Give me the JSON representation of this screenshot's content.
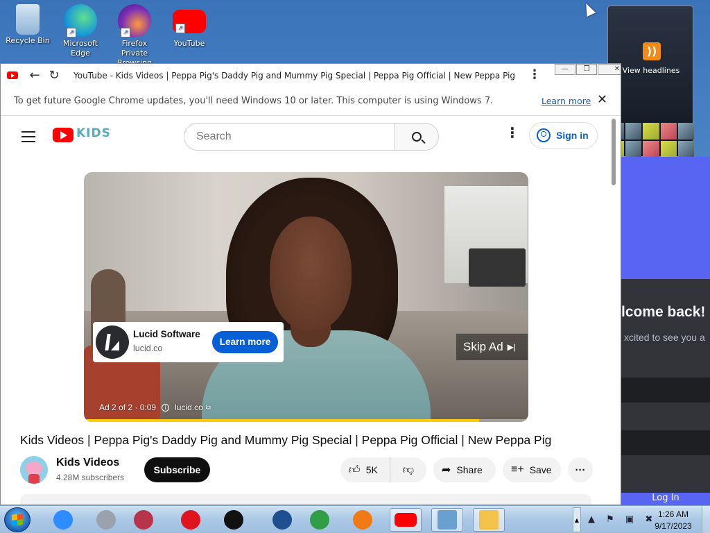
{
  "desktop": {
    "icons": [
      {
        "label": "Recycle Bin",
        "color": "#7fb0e0"
      },
      {
        "label": "Microsoft Edge",
        "color": "#1a9ad8"
      },
      {
        "label": "Firefox Private Browsing",
        "color": "#7b2fb8"
      },
      {
        "label": "YouTube",
        "color": "#ff0000"
      }
    ],
    "gadget_label": "View headlines"
  },
  "background_window": {
    "title": "lcome back!",
    "subtitle": "xcited to see you a",
    "button": "Log In"
  },
  "browser": {
    "tab_title": "YouTube - Kids Videos | Peppa Pig's Daddy Pig and Mummy Pig Special | Peppa Pig Official | New Peppa Pig - YouTube",
    "infobar_text": "To get future Google Chrome updates, you'll need Windows 10 or later. This computer is using Windows 7.",
    "infobar_link": "Learn more",
    "infobar_close": "✕",
    "menu": "⋮",
    "minimize": "—",
    "restore": "❐",
    "close": "✕"
  },
  "youtube": {
    "logo_kids_text": "KIDS",
    "search_placeholder": "Search",
    "more_menu": "⋮",
    "sign_in": "Sign in",
    "player": {
      "progress": 0.89,
      "ad_advertiser": "Lucid Software",
      "ad_domain": "lucid.co",
      "ad_cta": "Learn more",
      "skip": "Skip Ad",
      "skip_icon": "▶|",
      "ad_count": "Ad 2 of 2 · 0:09",
      "ad_link": "lucid.co"
    },
    "video_title": "Kids Videos | Peppa Pig's Daddy Pig and Mummy Pig Special | Peppa Pig Official | New Peppa Pig",
    "channel_name": "Kids Videos",
    "subscribers": "4.28M subscribers",
    "subscribe": "Subscribe",
    "likes": "5K",
    "share": "Share",
    "save": "Save",
    "more": "···"
  },
  "taskbar": {
    "apps": [
      {
        "name": "zoom",
        "color": "#2d8cff"
      },
      {
        "name": "pro-app",
        "color": "#9aa3ad"
      },
      {
        "name": "winrar",
        "color": "#b8344a"
      },
      {
        "name": "opera",
        "color": "#e0141e"
      },
      {
        "name": "recorder",
        "color": "#111111"
      },
      {
        "name": "virtualbox",
        "color": "#1e4f8f"
      },
      {
        "name": "windows-live",
        "color": "#2f9e44"
      },
      {
        "name": "avast",
        "color": "#f07a14"
      },
      {
        "name": "youtube",
        "color": "#ff0000"
      },
      {
        "name": "checklist-app",
        "color": "#6aa0d0"
      },
      {
        "name": "notes-app",
        "color": "#f2c24a"
      }
    ],
    "tray_icons": "▲ ⚑ ▣ ✖",
    "time": "1:26 AM",
    "date": "9/17/2023"
  }
}
